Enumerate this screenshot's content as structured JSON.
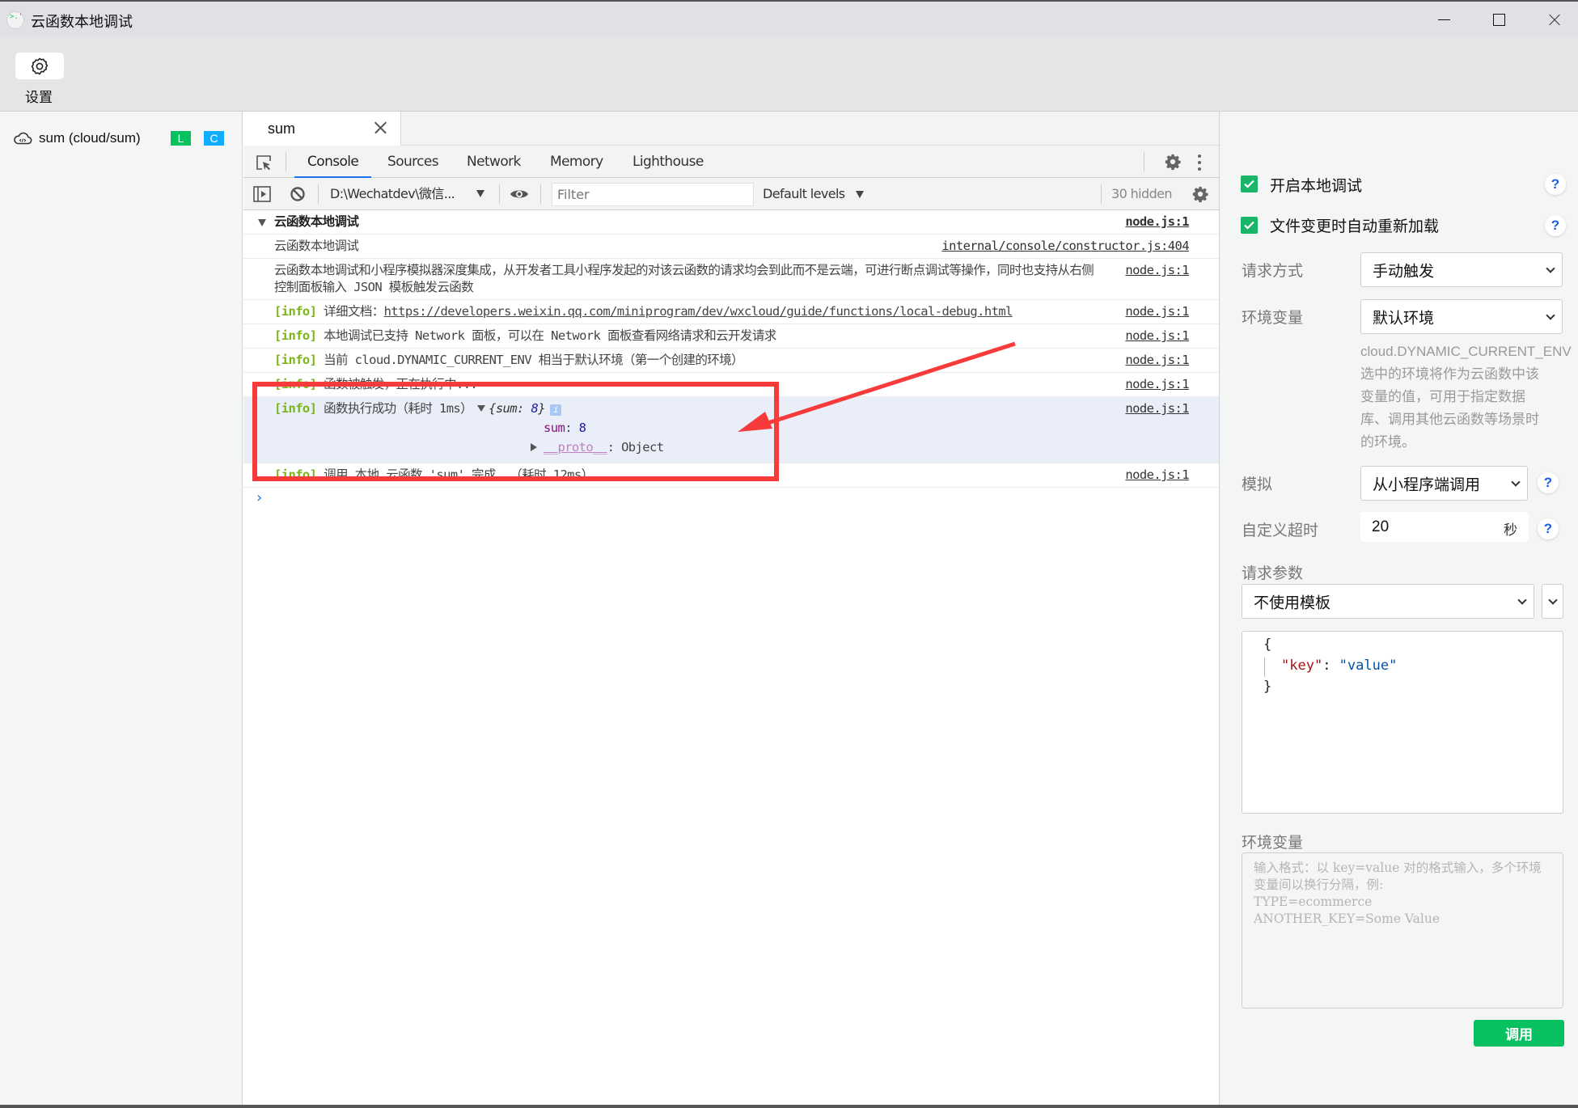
{
  "window": {
    "title": "云函数本地调试",
    "controls": {
      "minimize": "minimize",
      "maximize": "maximize",
      "close": "close"
    }
  },
  "toolbar": {
    "settings_label": "设置"
  },
  "sidebar": {
    "functions": [
      {
        "name": "sum (cloud/sum)",
        "badges": [
          {
            "text": "L",
            "color": "#07c160"
          },
          {
            "text": "C",
            "color": "#10aeff"
          }
        ]
      }
    ]
  },
  "editor_tabs": [
    {
      "label": "sum",
      "active": true
    }
  ],
  "devtools": {
    "tabs": [
      "Console",
      "Sources",
      "Network",
      "Memory",
      "Lighthouse"
    ],
    "active_tab": "Console",
    "console_toolbar": {
      "context": "D:\\Wechatdev\\微信...",
      "filter_placeholder": "Filter",
      "filter_value": "",
      "levels": "Default levels",
      "hidden_count": "30 hidden"
    },
    "logs": [
      {
        "type": "group",
        "text": "云函数本地调试",
        "source": "node.js:1"
      },
      {
        "type": "log",
        "text": "云函数本地调试",
        "source": "internal/console/constructor.js:404"
      },
      {
        "type": "log",
        "text": "云函数本地调试和小程序模拟器深度集成，从开发者工具小程序发起的对该云函数的请求均会到此而不是云端，可进行断点调试等操作，同时也支持从右侧控制面板输入 JSON 模板触发云函数",
        "source": "node.js:1"
      },
      {
        "type": "info",
        "tag": "[info]",
        "text": "详细文档：",
        "link": "https://developers.weixin.qq.com/miniprogram/dev/wxcloud/guide/functions/local-debug.html",
        "source": "node.js:1"
      },
      {
        "type": "info",
        "tag": "[info]",
        "text": "本地调试已支持 Network 面板，可以在 Network 面板查看网络请求和云开发请求",
        "source": "node.js:1"
      },
      {
        "type": "info",
        "tag": "[info]",
        "text": "当前 cloud.DYNAMIC_CURRENT_ENV 相当于默认环境（第一个创建的环境）",
        "source": "node.js:1"
      },
      {
        "type": "info",
        "tag": "[info]",
        "text": "函数被触发，正在执行中...",
        "source": "node.js:1"
      },
      {
        "type": "info-object",
        "tag": "[info]",
        "text": "函数执行成功（耗时 1ms）",
        "object_preview": {
          "open": "{",
          "key": "sum",
          "sep": ": ",
          "value": "8",
          "close": "}"
        },
        "info_badge": "i",
        "properties": [
          {
            "key": "sum",
            "value": "8"
          }
        ],
        "proto": {
          "key": "__proto__",
          "value": "Object"
        },
        "source": "node.js:1"
      },
      {
        "type": "info",
        "tag": "[info]",
        "text": "调用 本地 云函数 'sum' 完成  （耗时 12ms）",
        "source": "node.js:1"
      }
    ],
    "prompt": "›"
  },
  "right_panel": {
    "checkboxes": [
      {
        "label": "开启本地调试",
        "checked": true,
        "help": "?"
      },
      {
        "label": "文件变更时自动重新加载",
        "checked": true,
        "help": "?"
      }
    ],
    "request_method": {
      "label": "请求方式",
      "value": "手动触发"
    },
    "environment": {
      "label": "环境变量",
      "value": "默认环境",
      "note_title": "cloud.DYNAMIC_CURRENT_ENV",
      "note": "选中的环境将作为云函数中该变量的值，可用于指定数据库、调用其他云函数等场景时的环境。"
    },
    "simulate": {
      "label": "模拟",
      "value": "从小程序端调用",
      "help": "?"
    },
    "timeout": {
      "label": "自定义超时",
      "value": "20",
      "unit": "秒",
      "help": "?"
    },
    "params": {
      "label": "请求参数",
      "template": "不使用模板",
      "code": {
        "open": "{",
        "key": "\"key\"",
        "colon": ": ",
        "value": "\"value\"",
        "close": "}"
      }
    },
    "env_vars": {
      "label": "环境变量",
      "placeholder": "输入格式：以 key=value 对的格式输入，多个环境变量间以换行分隔，例:\nTYPE=ecommerce\nANOTHER_KEY=Some Value",
      "value": ""
    },
    "invoke_label": "调用"
  },
  "annotation": {
    "color": "#f73b3b",
    "target": "函数执行成功 log entries"
  }
}
